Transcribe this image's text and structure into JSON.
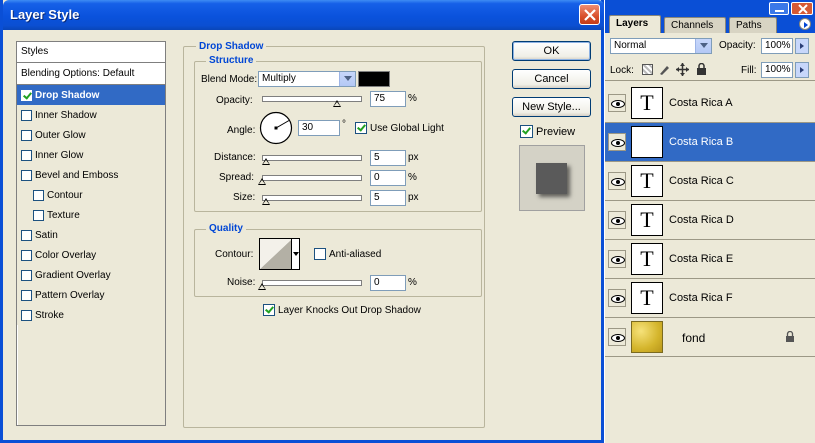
{
  "dialog": {
    "title": "Layer Style",
    "buttons": {
      "ok": "OK",
      "cancel": "Cancel",
      "new_style": "New Style..."
    },
    "preview_label": "Preview",
    "preview_checked": true
  },
  "styles": {
    "header": "Styles",
    "blending_options": "Blending Options: Default",
    "items": [
      {
        "label": "Drop Shadow",
        "checked": true,
        "selected": true,
        "indent": false
      },
      {
        "label": "Inner Shadow",
        "checked": false,
        "selected": false,
        "indent": false
      },
      {
        "label": "Outer Glow",
        "checked": false,
        "selected": false,
        "indent": false
      },
      {
        "label": "Inner Glow",
        "checked": false,
        "selected": false,
        "indent": false
      },
      {
        "label": "Bevel and Emboss",
        "checked": false,
        "selected": false,
        "indent": false
      },
      {
        "label": "Contour",
        "checked": false,
        "selected": false,
        "indent": true
      },
      {
        "label": "Texture",
        "checked": false,
        "selected": false,
        "indent": true
      },
      {
        "label": "Satin",
        "checked": false,
        "selected": false,
        "indent": false
      },
      {
        "label": "Color Overlay",
        "checked": false,
        "selected": false,
        "indent": false
      },
      {
        "label": "Gradient Overlay",
        "checked": false,
        "selected": false,
        "indent": false
      },
      {
        "label": "Pattern Overlay",
        "checked": false,
        "selected": false,
        "indent": false
      },
      {
        "label": "Stroke",
        "checked": false,
        "selected": false,
        "indent": false
      }
    ]
  },
  "drop_shadow": {
    "section_title": "Drop Shadow",
    "structure_title": "Structure",
    "blend_mode_label": "Blend Mode:",
    "blend_mode_value": "Multiply",
    "shadow_color": "#000000",
    "opacity_label": "Opacity:",
    "opacity_value": "75",
    "opacity_unit": "%",
    "opacity_fraction": 0.75,
    "angle_label": "Angle:",
    "angle_value": "30",
    "angle_unit": "°",
    "use_global_light_label": "Use Global Light",
    "use_global_light_checked": true,
    "distance_label": "Distance:",
    "distance_value": "5",
    "distance_unit": "px",
    "spread_label": "Spread:",
    "spread_value": "0",
    "spread_unit": "%",
    "size_label": "Size:",
    "size_value": "5",
    "size_unit": "px",
    "quality_title": "Quality",
    "contour_label": "Contour:",
    "anti_aliased_label": "Anti-aliased",
    "anti_aliased_checked": false,
    "noise_label": "Noise:",
    "noise_value": "0",
    "noise_unit": "%",
    "knocks_out_label": "Layer Knocks Out Drop Shadow",
    "knocks_out_checked": true
  },
  "layers_panel": {
    "tabs": [
      "Layers",
      "Channels",
      "Paths"
    ],
    "active_tab": "Layers",
    "blend_mode": "Normal",
    "opacity_label": "Opacity:",
    "opacity_value": "100%",
    "lock_label": "Lock:",
    "fill_label": "Fill:",
    "fill_value": "100%",
    "layers": [
      {
        "name": "Costa Rica A",
        "type": "text",
        "selected": false
      },
      {
        "name": "Costa Rica B",
        "type": "text",
        "selected": true
      },
      {
        "name": "Costa Rica C",
        "type": "text",
        "selected": false
      },
      {
        "name": "Costa Rica D",
        "type": "text",
        "selected": false
      },
      {
        "name": "Costa Rica E",
        "type": "text",
        "selected": false
      },
      {
        "name": "Costa Rica F",
        "type": "text",
        "selected": false
      },
      {
        "name": "fond",
        "type": "image",
        "selected": false,
        "locked": true
      }
    ]
  }
}
